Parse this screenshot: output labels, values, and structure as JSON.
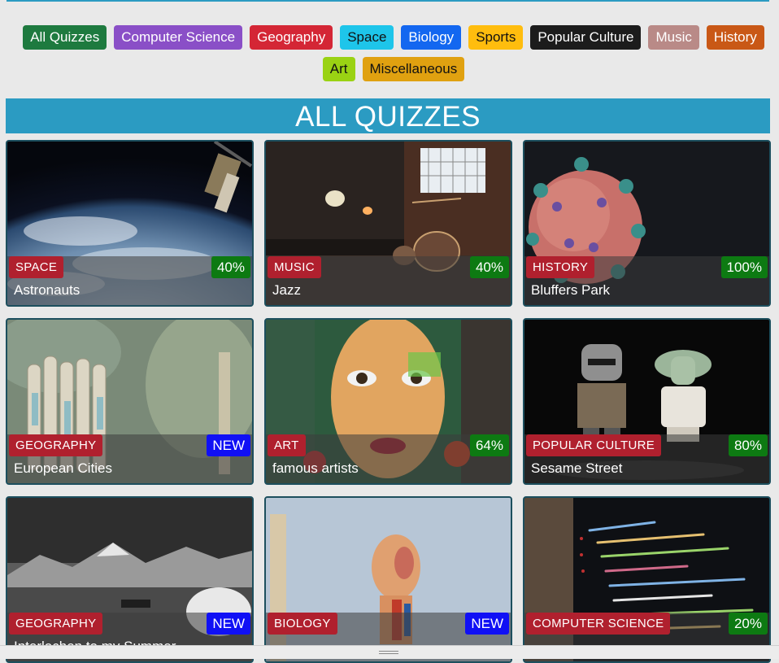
{
  "filters": [
    {
      "label": "All Quizzes",
      "bg": "#1e7a3f",
      "fg": "#ffffff"
    },
    {
      "label": "Computer Science",
      "bg": "#8a4fc7",
      "fg": "#ffffff"
    },
    {
      "label": "Geography",
      "bg": "#d42635",
      "fg": "#ffffff"
    },
    {
      "label": "Space",
      "bg": "#1ec5ea",
      "fg": "#111111"
    },
    {
      "label": "Biology",
      "bg": "#1367f0",
      "fg": "#ffffff"
    },
    {
      "label": "Sports",
      "bg": "#ffbd0e",
      "fg": "#111111"
    },
    {
      "label": "Popular Culture",
      "bg": "#1c1c1c",
      "fg": "#ffffff"
    },
    {
      "label": "Music",
      "bg": "#b98a87",
      "fg": "#ffffff"
    },
    {
      "label": "History",
      "bg": "#c95816",
      "fg": "#ffffff"
    },
    {
      "label": "Art",
      "bg": "#9ad213",
      "fg": "#111111"
    },
    {
      "label": "Miscellaneous",
      "bg": "#e0a110",
      "fg": "#111111"
    }
  ],
  "heading": "ALL QUIZZES",
  "cards": [
    {
      "category": "SPACE",
      "title": "Astronauts",
      "score": "40%",
      "is_new": false,
      "image": "earth-from-orbit"
    },
    {
      "category": "MUSIC",
      "title": "Jazz",
      "score": "40%",
      "is_new": false,
      "image": "drum-kit-room"
    },
    {
      "category": "HISTORY",
      "title": "Bluffers Park",
      "score": "100%",
      "is_new": false,
      "image": "virus-particle"
    },
    {
      "category": "GEOGRAPHY",
      "title": "European Cities",
      "score": "NEW",
      "is_new": true,
      "image": "rolled-maps"
    },
    {
      "category": "ART",
      "title": "famous artists",
      "score": "64%",
      "is_new": false,
      "image": "face-mural"
    },
    {
      "category": "POPULAR CULTURE",
      "title": "Sesame Street",
      "score": "80%",
      "is_new": false,
      "image": "toy-figures"
    },
    {
      "category": "GEOGRAPHY",
      "title": "Interlochen to my Summer",
      "score": "NEW",
      "is_new": true,
      "image": "mountain-lake"
    },
    {
      "category": "BIOLOGY",
      "title": "",
      "score": "NEW",
      "is_new": true,
      "image": "anatomy-model"
    },
    {
      "category": "COMPUTER SCIENCE",
      "title": "",
      "score": "20%",
      "is_new": false,
      "image": "code-screen"
    }
  ],
  "colors": {
    "accent": "#2b9bc2",
    "category_badge": "#b0202e",
    "score_badge": "#0d7a12",
    "new_badge": "#1010f5"
  }
}
